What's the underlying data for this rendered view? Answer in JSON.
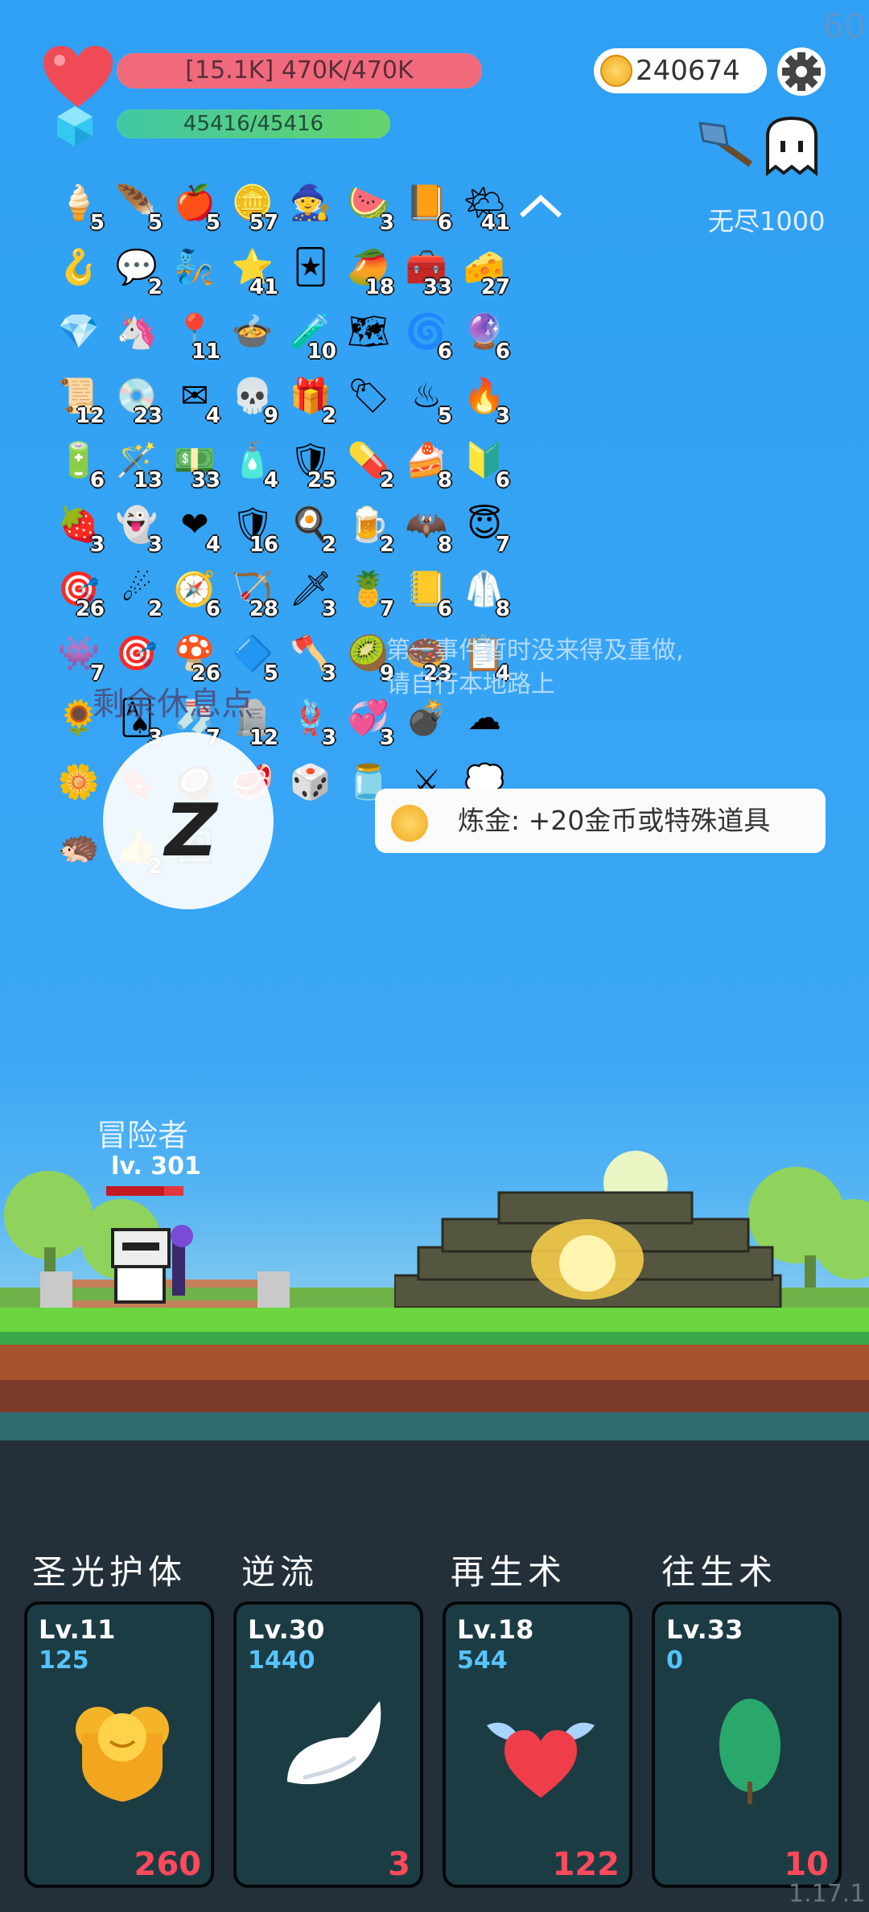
{
  "fps": "60",
  "hp": {
    "label": "[15.1K] 470K/470K",
    "fill": 1.0
  },
  "mp": {
    "label": "45416/45416",
    "fill": 1.0
  },
  "coins": "240674",
  "mode_label": "无尽1000",
  "items": [
    {
      "icon": "🍦",
      "count": "5"
    },
    {
      "icon": "🪶",
      "count": "5"
    },
    {
      "icon": "🍎",
      "count": "5"
    },
    {
      "icon": "🪙",
      "count": "57"
    },
    {
      "icon": "🧙",
      "count": ""
    },
    {
      "icon": "🍉",
      "count": "3"
    },
    {
      "icon": "📙",
      "count": "6"
    },
    {
      "icon": "🌤",
      "count": "41"
    },
    {
      "icon": "🪝",
      "count": ""
    },
    {
      "icon": "💬",
      "count": "2"
    },
    {
      "icon": "🧞",
      "count": ""
    },
    {
      "icon": "⭐",
      "count": "41"
    },
    {
      "icon": "🃏",
      "count": ""
    },
    {
      "icon": "🥭",
      "count": "18"
    },
    {
      "icon": "🧰",
      "count": "33"
    },
    {
      "icon": "🧀",
      "count": "27"
    },
    {
      "icon": "💎",
      "count": ""
    },
    {
      "icon": "🦄",
      "count": ""
    },
    {
      "icon": "📍",
      "count": "11"
    },
    {
      "icon": "🍲",
      "count": ""
    },
    {
      "icon": "🧪",
      "count": "10"
    },
    {
      "icon": "🗺",
      "count": ""
    },
    {
      "icon": "🌀",
      "count": "6"
    },
    {
      "icon": "🔮",
      "count": "6"
    },
    {
      "icon": "📜",
      "count": "12"
    },
    {
      "icon": "💿",
      "count": "23"
    },
    {
      "icon": "✉",
      "count": "4"
    },
    {
      "icon": "💀",
      "count": "9"
    },
    {
      "icon": "🎁",
      "count": "2"
    },
    {
      "icon": "🏷",
      "count": ""
    },
    {
      "icon": "♨",
      "count": "5"
    },
    {
      "icon": "🔥",
      "count": "3"
    },
    {
      "icon": "🔋",
      "count": "6"
    },
    {
      "icon": "🪄",
      "count": "13"
    },
    {
      "icon": "💵",
      "count": "33"
    },
    {
      "icon": "🧴",
      "count": "4"
    },
    {
      "icon": "🛡",
      "count": "25"
    },
    {
      "icon": "💊",
      "count": "2"
    },
    {
      "icon": "🍰",
      "count": "8"
    },
    {
      "icon": "🔰",
      "count": "6"
    },
    {
      "icon": "🍓",
      "count": "3"
    },
    {
      "icon": "👻",
      "count": "3"
    },
    {
      "icon": "❤",
      "count": "4"
    },
    {
      "icon": "🛡",
      "count": "16"
    },
    {
      "icon": "🍳",
      "count": "2"
    },
    {
      "icon": "🍺",
      "count": "2"
    },
    {
      "icon": "🦇",
      "count": "8"
    },
    {
      "icon": "😇",
      "count": "7"
    },
    {
      "icon": "🎯",
      "count": "26"
    },
    {
      "icon": "☄",
      "count": "2"
    },
    {
      "icon": "🧭",
      "count": "6"
    },
    {
      "icon": "🏹",
      "count": "28"
    },
    {
      "icon": "🗡",
      "count": "3"
    },
    {
      "icon": "🍍",
      "count": "7"
    },
    {
      "icon": "📒",
      "count": "6"
    },
    {
      "icon": "🥼",
      "count": "8"
    },
    {
      "icon": "👾",
      "count": "7"
    },
    {
      "icon": "🎯",
      "count": ""
    },
    {
      "icon": "🍄",
      "count": "26"
    },
    {
      "icon": "🔷",
      "count": "5"
    },
    {
      "icon": "🪓",
      "count": "3"
    },
    {
      "icon": "🥝",
      "count": "9"
    },
    {
      "icon": "🍩",
      "count": "23"
    },
    {
      "icon": "📋",
      "count": "4"
    },
    {
      "icon": "🌻",
      "count": ""
    },
    {
      "icon": "🂡",
      "count": "3"
    },
    {
      "icon": "🧦",
      "count": "7"
    },
    {
      "icon": "🪦",
      "count": "12"
    },
    {
      "icon": "🪢",
      "count": "3"
    },
    {
      "icon": "💞",
      "count": "3"
    },
    {
      "icon": "💣",
      "count": ""
    },
    {
      "icon": "☁",
      "count": ""
    },
    {
      "icon": "🌼",
      "count": ""
    },
    {
      "icon": "🔖",
      "count": ""
    },
    {
      "icon": "🥥",
      "count": ""
    },
    {
      "icon": "🥩",
      "count": ""
    },
    {
      "icon": "🎲",
      "count": ""
    },
    {
      "icon": "🫙",
      "count": "2"
    },
    {
      "icon": "⚔",
      "count": ""
    },
    {
      "icon": "💭",
      "count": "2"
    },
    {
      "icon": "🦔",
      "count": ""
    },
    {
      "icon": "👍",
      "count": "2"
    },
    {
      "icon": "🖼",
      "count": ""
    }
  ],
  "notice": {
    "line1": "第一事件暂时没来得及重做,",
    "line2": "请自行本地路上"
  },
  "rest_label": "剩余休息点",
  "rest_symbol": "Z",
  "tooltip": "炼金: +20金币或特殊道具",
  "adventurer": {
    "name": "冒险者",
    "level": "lv. 301",
    "hp_fill": 0.75
  },
  "skills": [
    {
      "title": "圣光护体",
      "level": "Lv.11",
      "value": "125",
      "cost": "260",
      "art": "golden-shield"
    },
    {
      "title": "逆流",
      "level": "Lv.30",
      "value": "1440",
      "cost": "3",
      "art": "white-wing"
    },
    {
      "title": "再生术",
      "level": "Lv.18",
      "value": "544",
      "cost": "122",
      "art": "winged-heart"
    },
    {
      "title": "往生术",
      "level": "Lv.33",
      "value": "0",
      "cost": "10",
      "art": "green-leaf"
    }
  ],
  "version": "1.17.1",
  "colors": {
    "sky": "#3aa6f5",
    "hp": "#f16a7b",
    "mp": "#4fcf86",
    "cost": "#ff4a5c",
    "skill_value": "#56c4ff"
  }
}
